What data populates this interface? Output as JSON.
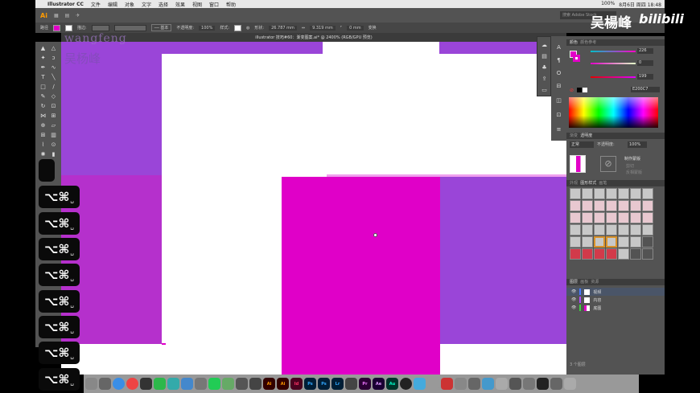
{
  "mac_menu": {
    "app": "Illustrator CC",
    "items": [
      "文件",
      "编辑",
      "对象",
      "文字",
      "选择",
      "效果",
      "视图",
      "窗口",
      "帮助"
    ],
    "right": [
      "100%",
      "8月6日 周四 18:48"
    ]
  },
  "control": {
    "label": "路径",
    "stroke_label": "描边:",
    "style_label": "基本",
    "opacity_label": "不透明度:",
    "opacity": "100%",
    "style2_label": "样式:",
    "shape_label": "形状:",
    "width": "26.787 mm",
    "height": "9.319 mm",
    "corner": "0 mm",
    "transform_label": "变换"
  },
  "search": {
    "placeholder": "搜索 Adobe Stock"
  },
  "doc_tab": {
    "title": "illustrator 技巧#60：渐变图案.ai* @ 2400% (RGB/GPU 预览)"
  },
  "watermark": {
    "name_en": "wangfeng",
    "name_cn": "吴杨峰"
  },
  "brand": {
    "cn": "吴楊峰",
    "logo": "bilibili"
  },
  "key_overlay": {
    "label": "⌥⌘",
    "suffix": "␣",
    "count": 8
  },
  "color_panel": {
    "tab1": "颜色",
    "tab2": "颜色参考",
    "r": "226",
    "g": "0",
    "b": "199",
    "hex": "E200C7",
    "fill_color": "#e200c7"
  },
  "transparency_panel": {
    "tab1": "渐变",
    "tab2": "透明度",
    "mode": "正常",
    "opacity_label": "不透明度:",
    "opacity": "100%",
    "make_mask": "制作蒙版",
    "clip": "剪切",
    "invert": "反相蒙版"
  },
  "swatch_panel": {
    "tab1": "外观",
    "tab2": "图形样式",
    "tab3": "画笔"
  },
  "layers_panel": {
    "tab1": "图层",
    "tab2": "画板",
    "tab3": "资源",
    "layers": [
      {
        "name": "视频",
        "color": "#4a7cff"
      },
      {
        "name": "内容",
        "color": "#b04aff"
      },
      {
        "name": "底图",
        "color": "#3fcf3f"
      }
    ],
    "footer": "3 个图层"
  },
  "colors": {
    "purple": "#9a45d8",
    "magenta": "#e000c8",
    "magenta_light": "#b530cc",
    "panel": "#535353"
  }
}
